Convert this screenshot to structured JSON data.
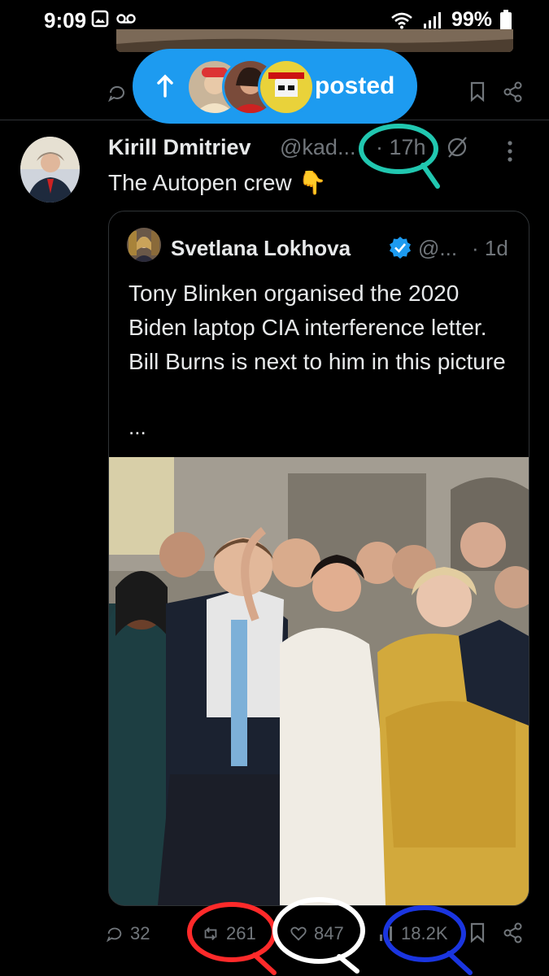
{
  "status_bar": {
    "time": "9:09",
    "battery": "99%",
    "icons": [
      "image-icon",
      "voicemail-icon",
      "wifi-icon",
      "signal-icon",
      "battery-icon"
    ]
  },
  "new_posts_pill": {
    "label": "posted",
    "icon": "arrow-up-icon",
    "avatar_count": 3,
    "color": "#1d9bf0"
  },
  "tweet": {
    "author_name": "Kirill Dmitriev",
    "author_handle": "@kad...",
    "time": "· 17h",
    "text": "The Autopen crew 👇",
    "quote": {
      "author_name": "Svetlana Lokhova",
      "author_handle": "@...",
      "time": "· 1d",
      "verified": true,
      "text": "Tony Blinken organised the 2020 Biden laptop CIA interference letter. Bill Burns is next to him in this picture",
      "ellipsis": "..."
    },
    "actions": {
      "replies": "32",
      "reposts": "261",
      "likes": "847",
      "views": "18.2K"
    }
  },
  "annotations": {
    "teal": "#21c7b0",
    "red": "#ff2a2a",
    "white": "#ffffff",
    "blue": "#1a35e0"
  }
}
